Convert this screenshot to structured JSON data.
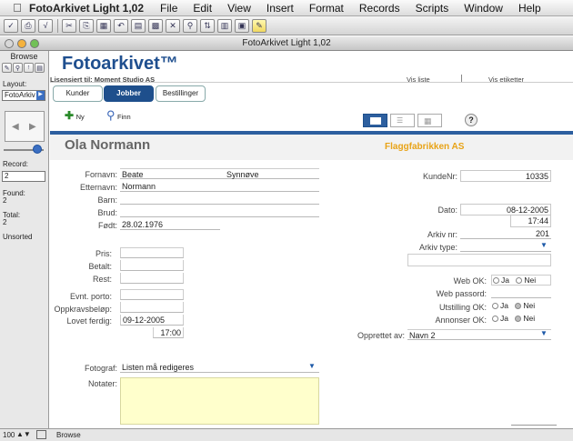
{
  "menubar": {
    "app": "FotoArkivet Light 1,02",
    "items": [
      "File",
      "Edit",
      "View",
      "Insert",
      "Format",
      "Records",
      "Scripts",
      "Window",
      "Help"
    ]
  },
  "window_title": "FotoArkivet Light 1,02",
  "status": {
    "mode": "Browse",
    "layout_label": "Layout:",
    "layout_value": "FotoArkiv",
    "record_label": "Record:",
    "record_value": "2",
    "found_label": "Found:",
    "found_value": "2",
    "total_label": "Total:",
    "total_value": "2",
    "sort": "Unsorted",
    "zoom": "100",
    "bottom_mode": "Browse"
  },
  "header": {
    "title": "Fotoarkivet™",
    "license": "Lisensiert til: Moment Studio AS",
    "vis_liste": "Vis liste",
    "vis_etiketter": "Vis etiketter",
    "tabs": [
      "Kunder",
      "Jobber",
      "Bestillinger"
    ],
    "ny": "Ny",
    "finn": "Finn"
  },
  "record": {
    "name": "Ola Normann",
    "company": "Flaggfabrikken AS",
    "fornavn_label": "Fornavn:",
    "fornavn": "Beate",
    "fornavn2": "Synnøve",
    "etternavn_label": "Etternavn:",
    "etternavn": "Normann",
    "barn_label": "Barn:",
    "brud_label": "Brud:",
    "fodt_label": "Født:",
    "fodt": "28.02.1976",
    "pris_label": "Pris:",
    "betalt_label": "Betalt:",
    "rest_label": "Rest:",
    "porto_label": "Evnt. porto:",
    "oppkrav_label": "Oppkravsbeløp:",
    "lovet_label": "Lovet ferdig:",
    "lovet": "09-12-2005",
    "lovet_time": "17:00",
    "fotograf_label": "Fotograf:",
    "fotograf": "Listen må redigeres",
    "notater_label": "Notater:",
    "kundenr_label": "KundeNr:",
    "kundenr": "10335",
    "dato_label": "Dato:",
    "dato": "08-12-2005",
    "dato_time": "17:44",
    "arkivnr_label": "Arkiv nr:",
    "arkivnr": "201",
    "arkivtype_label": "Arkiv type:",
    "webok_label": "Web OK:",
    "webpassord_label": "Web passord:",
    "utstilling_label": "Utstilling OK:",
    "annonser_label": "Annonser OK:",
    "ja": "Ja",
    "nei": "Nei",
    "opprettet_label": "Opprettet av:",
    "opprettet": "Navn 2"
  },
  "colors": {
    "accent": "#1e4f8c",
    "company": "#e8a317",
    "notes_bg": "#ffffcc"
  }
}
